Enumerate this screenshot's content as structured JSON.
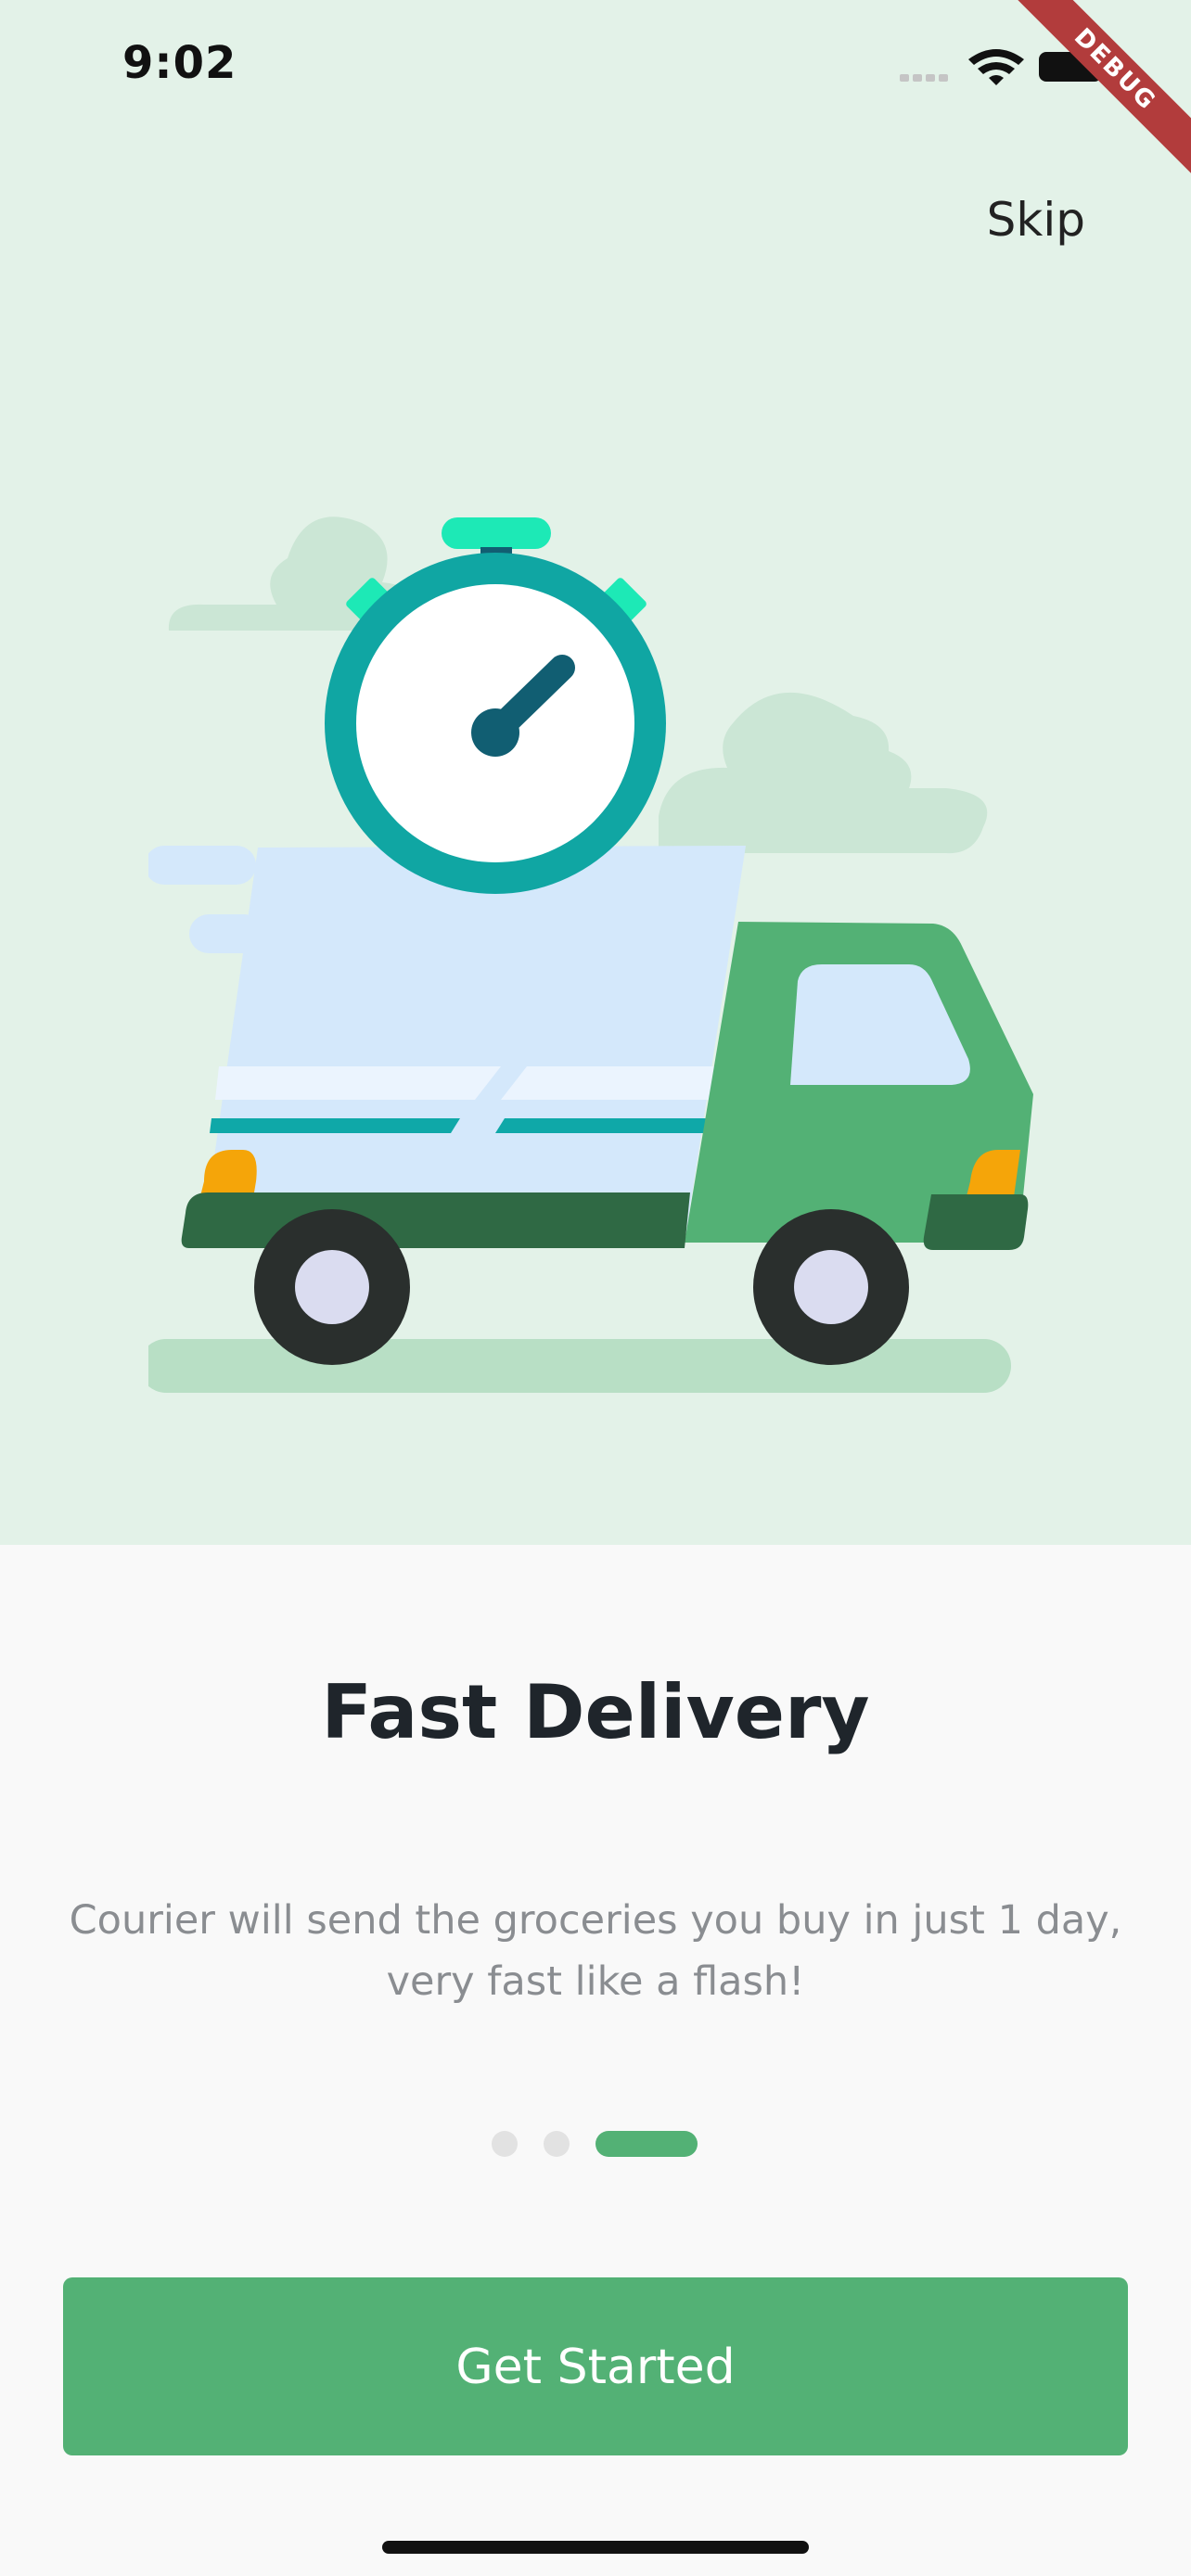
{
  "status_bar": {
    "time": "9:02",
    "icons": [
      "cellular-signal-icon",
      "wifi-icon",
      "battery-icon"
    ]
  },
  "debug_banner": "DEBUG",
  "skip_label": "Skip",
  "illustration": {
    "icons": [
      "cloud-icon",
      "stopwatch-icon",
      "delivery-truck-icon"
    ]
  },
  "onboarding": {
    "title": "Fast Delivery",
    "description": "Courier will send the groceries you buy in just 1 day, very fast like a flash!",
    "page_count": 3,
    "active_page": 3
  },
  "cta_label": "Get Started",
  "colors": {
    "accent": "#53b175",
    "hero_bg": "#e3f2e8",
    "page_bg": "#f9f9f9",
    "title": "#1f252b",
    "description": "#8a8d91",
    "inactive_dot": "#e2e2e2"
  }
}
